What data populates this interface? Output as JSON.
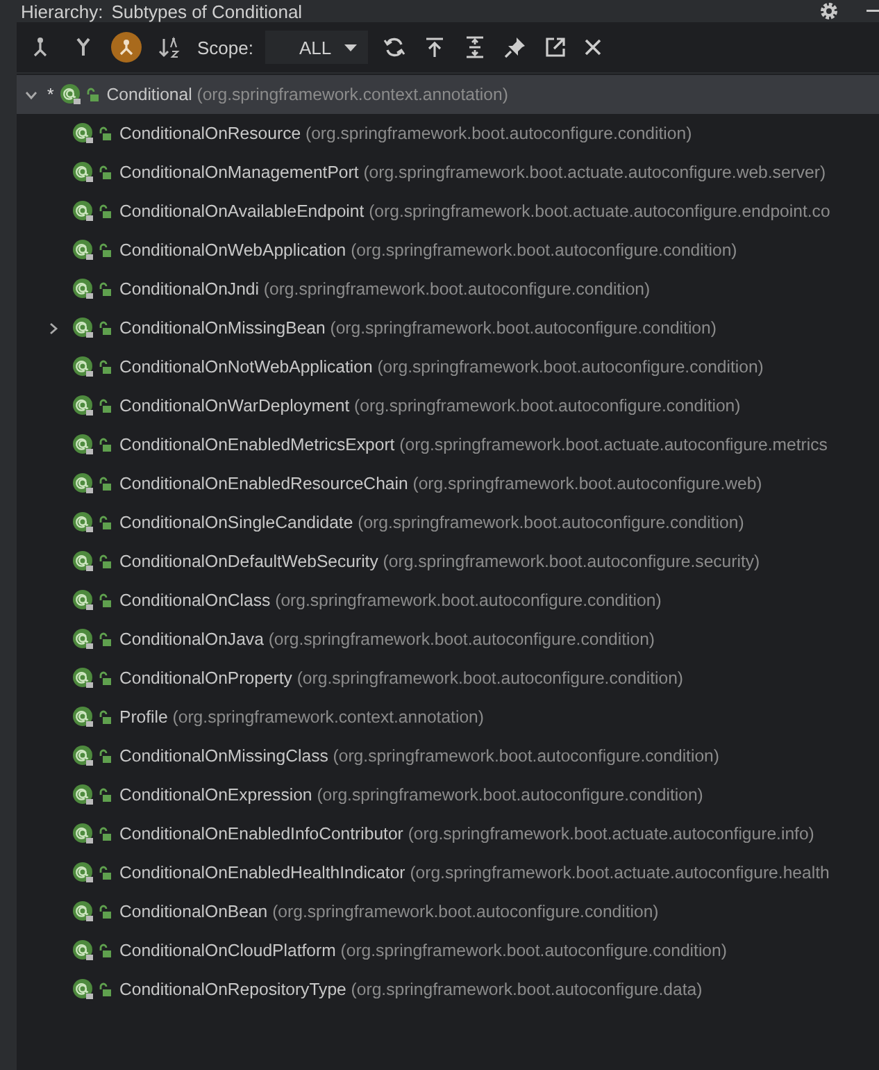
{
  "header": {
    "title": "Hierarchy:",
    "subtitle": "Subtypes of Conditional"
  },
  "toolbar": {
    "scope_label": "Scope:",
    "scope_value": "ALL",
    "buttons": [
      {
        "kind": "supertypes",
        "selected": false
      },
      {
        "kind": "subtypes",
        "selected": false
      },
      {
        "kind": "class",
        "selected": true
      },
      {
        "kind": "sort",
        "selected": false
      }
    ]
  },
  "tree": {
    "root": {
      "marker": "*",
      "name": "Conditional",
      "package": "(org.springframework.context.annotation)",
      "expanded": true,
      "selected": true,
      "children": [
        {
          "name": "ConditionalOnResource",
          "package": "(org.springframework.boot.autoconfigure.condition)"
        },
        {
          "name": "ConditionalOnManagementPort",
          "package": "(org.springframework.boot.actuate.autoconfigure.web.server)"
        },
        {
          "name": "ConditionalOnAvailableEndpoint",
          "package": "(org.springframework.boot.actuate.autoconfigure.endpoint.co"
        },
        {
          "name": "ConditionalOnWebApplication",
          "package": "(org.springframework.boot.autoconfigure.condition)"
        },
        {
          "name": "ConditionalOnJndi",
          "package": "(org.springframework.boot.autoconfigure.condition)"
        },
        {
          "name": "ConditionalOnMissingBean",
          "package": "(org.springframework.boot.autoconfigure.condition)",
          "expanded": false
        },
        {
          "name": "ConditionalOnNotWebApplication",
          "package": "(org.springframework.boot.autoconfigure.condition)"
        },
        {
          "name": "ConditionalOnWarDeployment",
          "package": "(org.springframework.boot.autoconfigure.condition)"
        },
        {
          "name": "ConditionalOnEnabledMetricsExport",
          "package": "(org.springframework.boot.actuate.autoconfigure.metrics"
        },
        {
          "name": "ConditionalOnEnabledResourceChain",
          "package": "(org.springframework.boot.autoconfigure.web)"
        },
        {
          "name": "ConditionalOnSingleCandidate",
          "package": "(org.springframework.boot.autoconfigure.condition)"
        },
        {
          "name": "ConditionalOnDefaultWebSecurity",
          "package": "(org.springframework.boot.autoconfigure.security)"
        },
        {
          "name": "ConditionalOnClass",
          "package": "(org.springframework.boot.autoconfigure.condition)"
        },
        {
          "name": "ConditionalOnJava",
          "package": "(org.springframework.boot.autoconfigure.condition)"
        },
        {
          "name": "ConditionalOnProperty",
          "package": "(org.springframework.boot.autoconfigure.condition)"
        },
        {
          "name": "Profile",
          "package": "(org.springframework.context.annotation)"
        },
        {
          "name": "ConditionalOnMissingClass",
          "package": "(org.springframework.boot.autoconfigure.condition)"
        },
        {
          "name": "ConditionalOnExpression",
          "package": "(org.springframework.boot.autoconfigure.condition)"
        },
        {
          "name": "ConditionalOnEnabledInfoContributor",
          "package": "(org.springframework.boot.actuate.autoconfigure.info)"
        },
        {
          "name": "ConditionalOnEnabledHealthIndicator",
          "package": "(org.springframework.boot.actuate.autoconfigure.health"
        },
        {
          "name": "ConditionalOnBean",
          "package": "(org.springframework.boot.autoconfigure.condition)"
        },
        {
          "name": "ConditionalOnCloudPlatform",
          "package": "(org.springframework.boot.autoconfigure.condition)"
        },
        {
          "name": "ConditionalOnRepositoryType",
          "package": "(org.springframework.boot.autoconfigure.data)"
        }
      ]
    }
  }
}
